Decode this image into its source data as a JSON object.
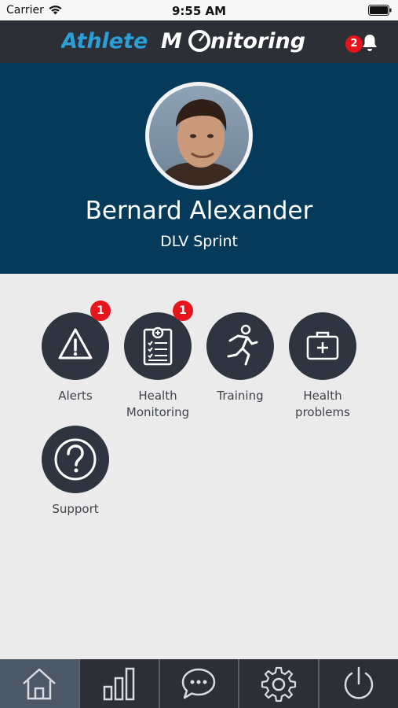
{
  "status_bar": {
    "carrier": "Carrier",
    "time": "9:55 AM"
  },
  "header": {
    "logo_text_part1": "Athlete",
    "logo_text_part2": "M",
    "logo_text_part3": "nitoring",
    "notification_count": "2"
  },
  "profile": {
    "name": "Bernard Alexander",
    "team": "DLV Sprint"
  },
  "menu": {
    "items": [
      {
        "label": "Alerts",
        "icon": "warning-icon",
        "badge": "1"
      },
      {
        "label": "Health\nMonitoring",
        "icon": "clipboard-checklist-icon",
        "badge": "1"
      },
      {
        "label": "Training",
        "icon": "runner-icon"
      },
      {
        "label": "Health\nproblems",
        "icon": "medical-kit-icon"
      },
      {
        "label": "Support",
        "icon": "question-icon"
      }
    ]
  },
  "bottom_nav": {
    "items": [
      {
        "icon": "home-icon",
        "active": true
      },
      {
        "icon": "bar-chart-icon"
      },
      {
        "icon": "chat-icon"
      },
      {
        "icon": "gear-icon"
      },
      {
        "icon": "power-icon"
      }
    ]
  },
  "colors": {
    "header_bg": "#2c2f36",
    "profile_bg": "#053a5b",
    "logo_blue": "#2a9fd8",
    "badge_red": "#e8141b",
    "tile_bg": "#2f3540",
    "nav_active": "#4d5866"
  }
}
